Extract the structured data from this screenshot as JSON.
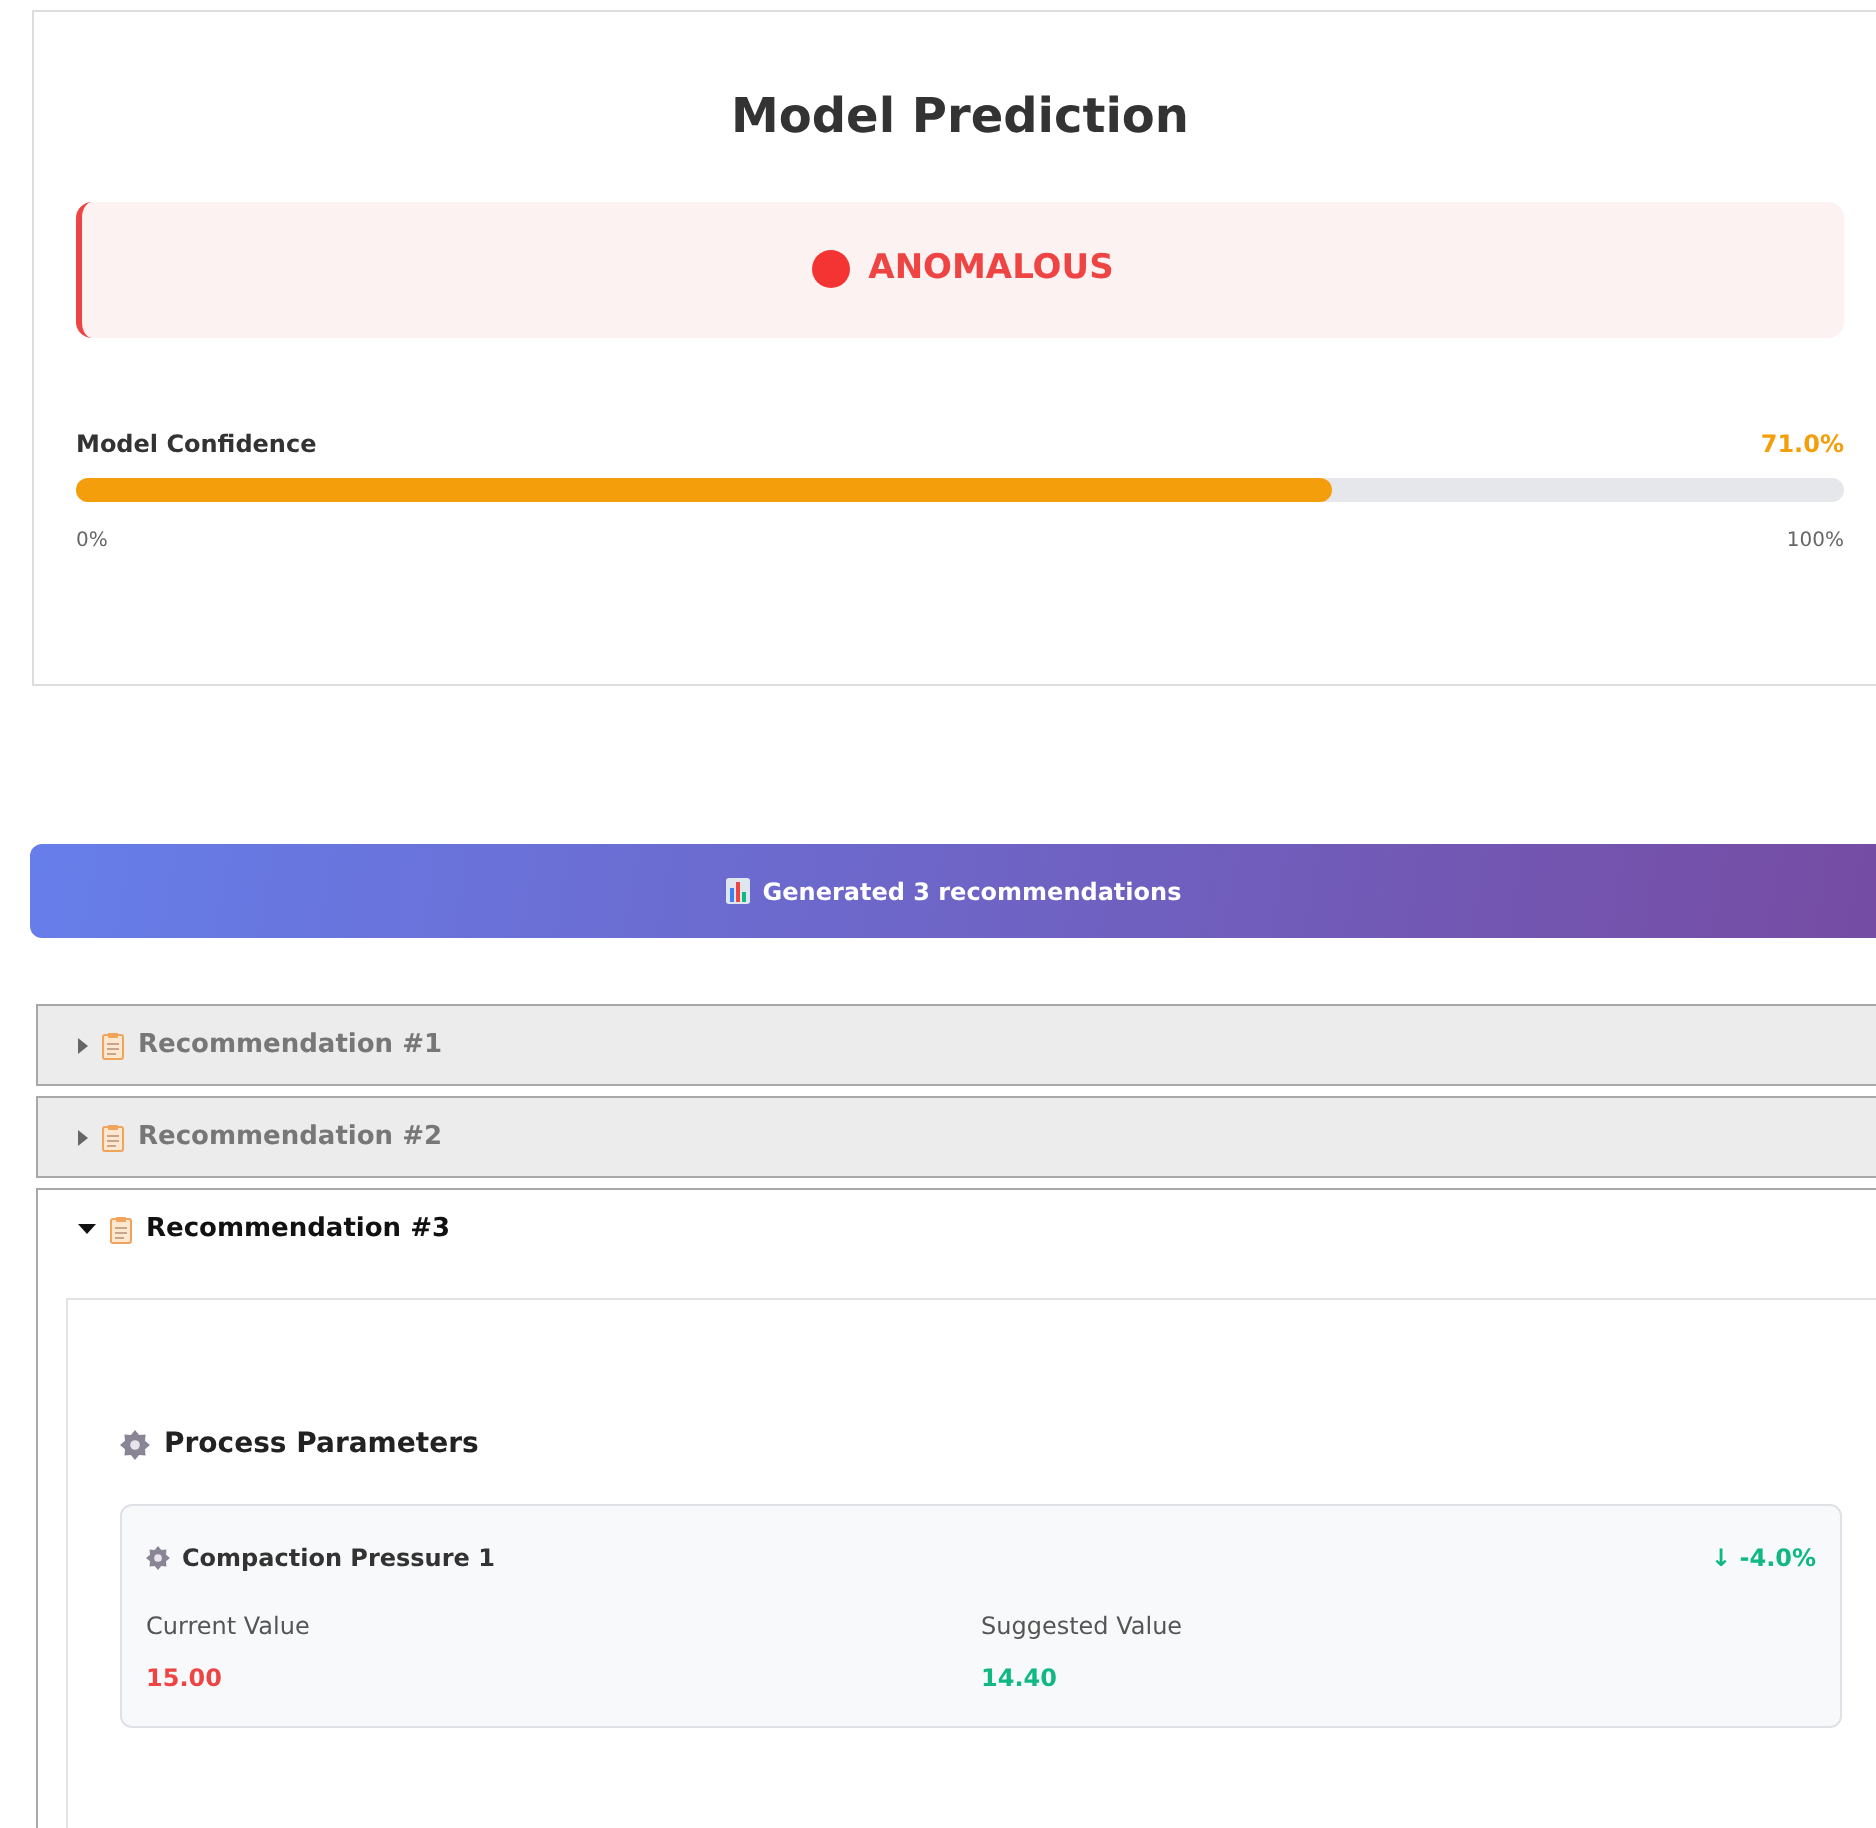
{
  "prediction": {
    "title": "Model Prediction",
    "status": {
      "label": "ANOMALOUS",
      "kind": "anomalous"
    },
    "confidence": {
      "label": "Model Confidence",
      "reading": "71.0%",
      "level": 0.71,
      "min_label": "0%",
      "max_label": "100%"
    }
  },
  "banner": {
    "text": "Generated 3 recommendations"
  },
  "recommendations": [
    {
      "title": "Recommendation #1",
      "expanded": false
    },
    {
      "title": "Recommendation #2",
      "expanded": false
    },
    {
      "title": "Recommendation #3",
      "expanded": true,
      "section": {
        "title": "Process Parameters",
        "parameters": [
          {
            "name": "Compaction Pressure 1",
            "change": "↓ -4.0%",
            "current_label": "Current Value",
            "current": "15.00",
            "suggested_label": "Suggested Value",
            "suggested": "14.40"
          }
        ]
      }
    }
  ]
}
